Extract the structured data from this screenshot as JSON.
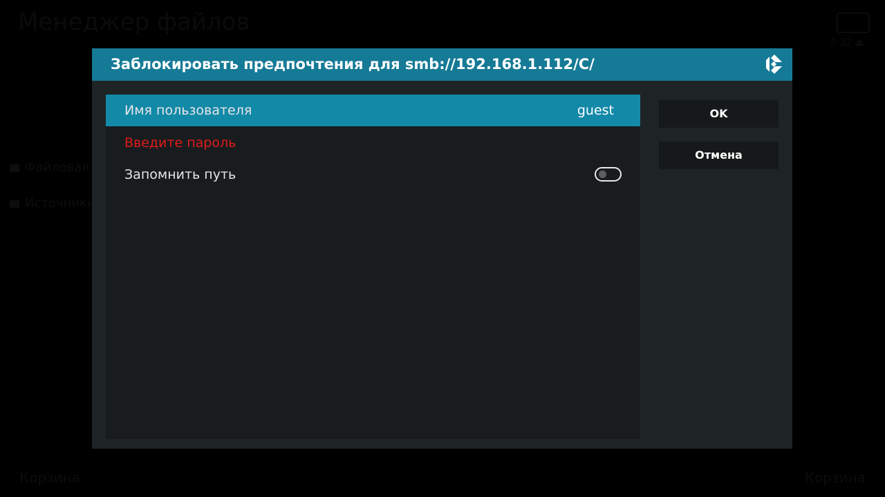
{
  "background": {
    "title": "Менеджер файлов",
    "side_items": [
      "Файловая",
      "Источники"
    ],
    "footer_left": "Корзина",
    "footer_right": "Корзина",
    "clock": "5:32 ⏏"
  },
  "dialog": {
    "title": "Заблокировать предпочтения для smb://192.168.1.112/C/",
    "logo_icon": "kodi-logo-icon",
    "settings": [
      {
        "label": "Имя пользователя",
        "value": "guest",
        "focused": true
      },
      {
        "label": "Введите пароль",
        "warning": true
      },
      {
        "label": "Запомнить путь",
        "toggle": false
      }
    ],
    "buttons": {
      "ok": "OK",
      "cancel": "Отмена"
    }
  },
  "colors": {
    "header": "#157a96",
    "focused_row": "#1389a8",
    "warning_text": "#e01b1b",
    "dialog_bg": "#1e2426",
    "panel_bg": "#181c1e"
  }
}
